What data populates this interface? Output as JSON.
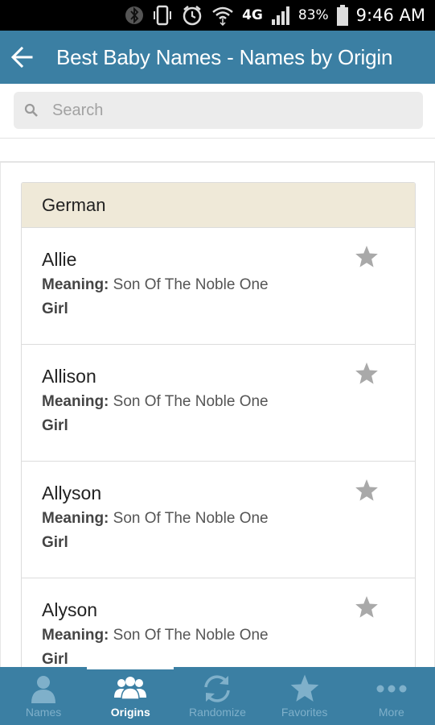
{
  "status_bar": {
    "battery": "83%",
    "time": "9:46 AM",
    "network": "4G",
    "icons": [
      "bluetooth-icon",
      "vibrate-icon",
      "alarm-icon",
      "wifi-icon",
      "signal-icon",
      "battery-icon"
    ]
  },
  "app_bar": {
    "title": "Best Baby Names - Names by Origin",
    "back_icon": "arrow-left-icon"
  },
  "search": {
    "placeholder": "Search",
    "value": ""
  },
  "list": {
    "group_header": "German",
    "meaning_label": "Meaning:",
    "items": [
      {
        "name": "Allie",
        "meaning": "Son Of The Noble One",
        "gender": "Girl"
      },
      {
        "name": "Allison",
        "meaning": "Son Of The Noble One",
        "gender": "Girl"
      },
      {
        "name": "Allyson",
        "meaning": "Son Of The Noble One",
        "gender": "Girl"
      },
      {
        "name": "Alyson",
        "meaning": "Son Of The Noble One",
        "gender": "Girl"
      }
    ]
  },
  "bottom_nav": {
    "items": [
      {
        "label": "Names",
        "icon": "person-icon",
        "active": false
      },
      {
        "label": "Origins",
        "icon": "group-icon",
        "active": true
      },
      {
        "label": "Randomize",
        "icon": "refresh-icon",
        "active": false
      },
      {
        "label": "Favorites",
        "icon": "star-icon",
        "active": false
      },
      {
        "label": "More",
        "icon": "more-icon",
        "active": false
      }
    ]
  },
  "colors": {
    "app_bar": "#3b7fa3",
    "group_header_bg": "#efe9d8",
    "nav_inactive": "#7fb0ca",
    "star": "#aaaaaa"
  }
}
